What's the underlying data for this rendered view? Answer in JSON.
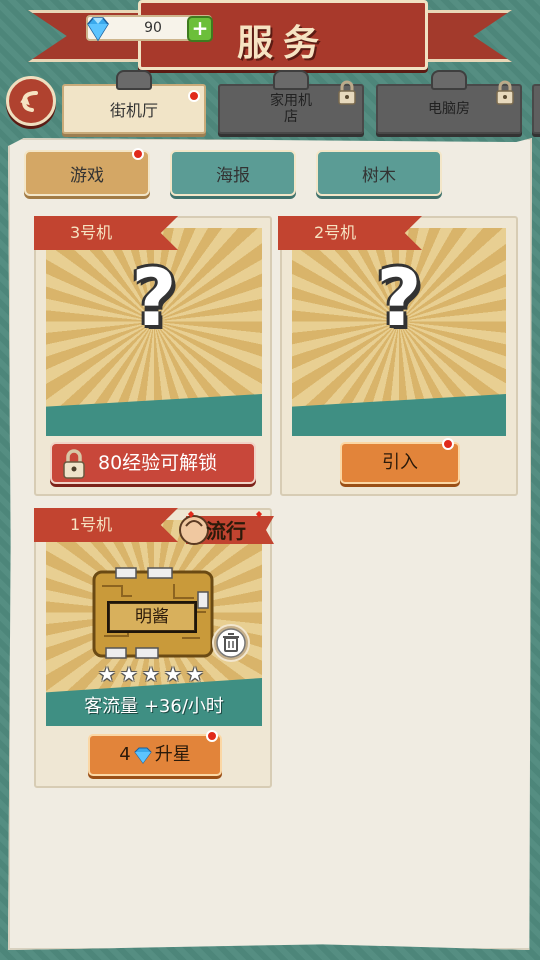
{
  "header": {
    "title": "服务",
    "currency_value": "90",
    "plus_label": "+"
  },
  "tabs": [
    {
      "label": "街机厅",
      "active": true,
      "locked": false,
      "badge": true
    },
    {
      "label": "家用机店",
      "active": false,
      "locked": true
    },
    {
      "label": "电脑房",
      "active": false,
      "locked": true
    }
  ],
  "subtabs": [
    {
      "label": "游戏",
      "active": true,
      "badge": true
    },
    {
      "label": "海报",
      "active": false
    },
    {
      "label": "树木",
      "active": false
    }
  ],
  "machines": [
    {
      "label": "3号机",
      "state": "locked",
      "action": "80经验可解锁",
      "mystery": "?"
    },
    {
      "label": "2号机",
      "state": "available",
      "action": "引入",
      "mystery": "?",
      "badge": true
    },
    {
      "label": "1号机",
      "state": "owned",
      "game_name": "明酱",
      "stars": 5,
      "filled_stars": 0,
      "traffic": "客流量 +36/小时",
      "upgrade_cost": "4",
      "upgrade_label": "升星",
      "tag": "流行",
      "badge": true
    }
  ],
  "colors": {
    "background": "#4f8a7e",
    "banner_red": "#a8392b",
    "panel": "#f0ece2",
    "accent_orange": "#e2843a",
    "teal": "#3f8f83"
  }
}
